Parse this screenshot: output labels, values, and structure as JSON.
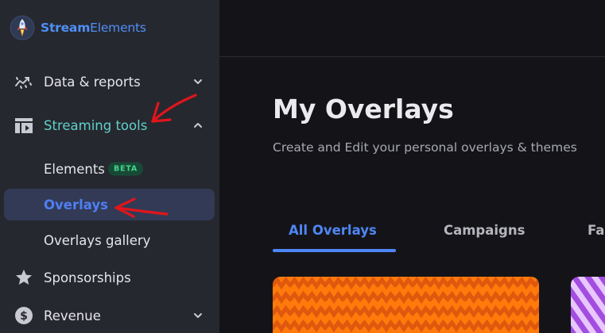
{
  "brand": {
    "name_bold": "Stream",
    "name_rest": "Elements",
    "logo_icon": "rocket-logo-icon"
  },
  "sidebar": {
    "items": [
      {
        "label": "Data & reports",
        "icon": "trend-chart-icon",
        "expanded": false
      },
      {
        "label": "Streaming tools",
        "icon": "stream-panel-icon",
        "expanded": true,
        "active": true
      },
      {
        "label": "Sponsorships",
        "icon": "star-icon"
      },
      {
        "label": "Revenue",
        "icon": "dollar-icon",
        "expanded": false
      }
    ],
    "subitems": [
      {
        "label": "Elements",
        "badge": "BETA"
      },
      {
        "label": "Overlays",
        "selected": true
      },
      {
        "label": "Overlays gallery"
      }
    ]
  },
  "main": {
    "title": "My Overlays",
    "subtitle": "Create and Edit your personal overlays & themes",
    "tabs": [
      {
        "label": "All Overlays",
        "active": true
      },
      {
        "label": "Campaigns"
      },
      {
        "label": "Fa"
      }
    ]
  },
  "colors": {
    "sidebar_bg": "#26282f",
    "main_bg": "#141418",
    "accent_blue": "#4f86f5",
    "active_teal": "#5fd1c9",
    "beta_green": "#46d58c",
    "annotation_red": "#e0151b",
    "card1_primary": "#ff7a0a",
    "card1_secondary": "#e0580e",
    "card2_primary": "#a34de0"
  }
}
